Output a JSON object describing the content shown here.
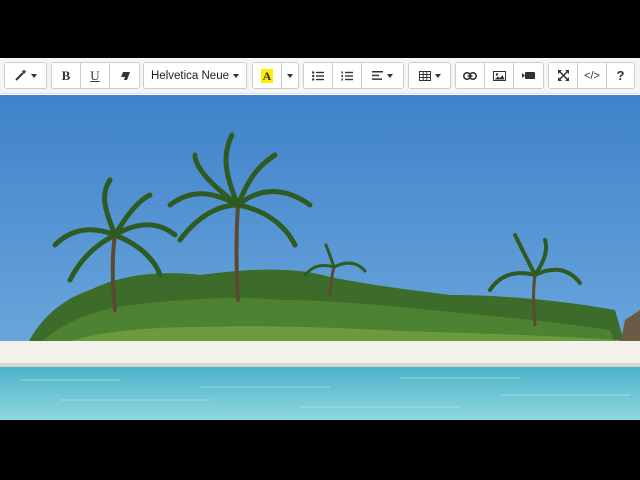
{
  "toolbar": {
    "magic_icon": "magic-wand-icon",
    "bold_label": "B",
    "underline_label": "U",
    "eraser_icon": "eraser-icon",
    "font_family": "Helvetica Neue",
    "highlight_label": "A",
    "highlight_color": "#ffee00",
    "unordered_list_icon": "unordered-list-icon",
    "ordered_list_icon": "ordered-list-icon",
    "align_icon": "align-left-icon",
    "table_icon": "table-icon",
    "link_icon": "link-icon",
    "picture_icon": "picture-icon",
    "video_icon": "video-icon",
    "fullscreen_icon": "fullscreen-icon",
    "codeview_label": "</>",
    "help_label": "?"
  },
  "content": {
    "image_description_colors": {
      "sky": "#4f8fd0",
      "sand": "#f2f1ec",
      "water": "#6cc6d6"
    }
  }
}
